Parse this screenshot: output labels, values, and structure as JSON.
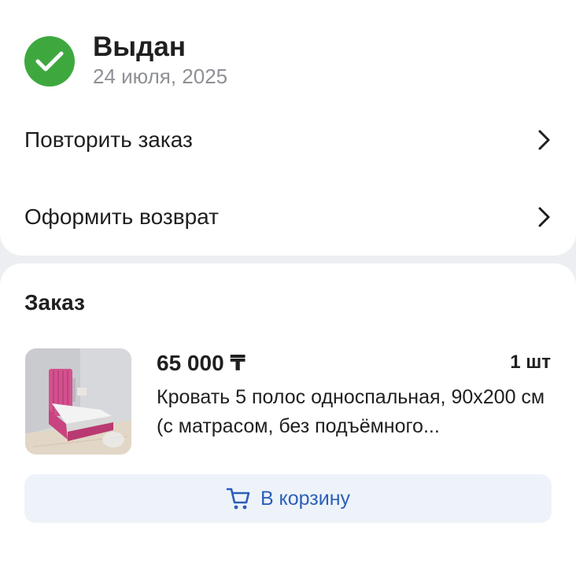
{
  "status": {
    "title": "Выдан",
    "date": "24 июля, 2025",
    "color": "#3ea83f"
  },
  "actions": [
    {
      "label": "Повторить заказ",
      "icon": "chevron-right-icon"
    },
    {
      "label": "Оформить возврат",
      "icon": "chevron-right-icon"
    }
  ],
  "order": {
    "section_title": "Заказ",
    "item": {
      "price": "65 000 ₸",
      "quantity": "1 шт",
      "name": "Кровать 5 полос односпальная, 90х200 см (с матрасом, без подъёмного..."
    },
    "cart_button": {
      "label": "В корзину",
      "icon": "cart-icon",
      "color": "#2b5fb8"
    }
  }
}
